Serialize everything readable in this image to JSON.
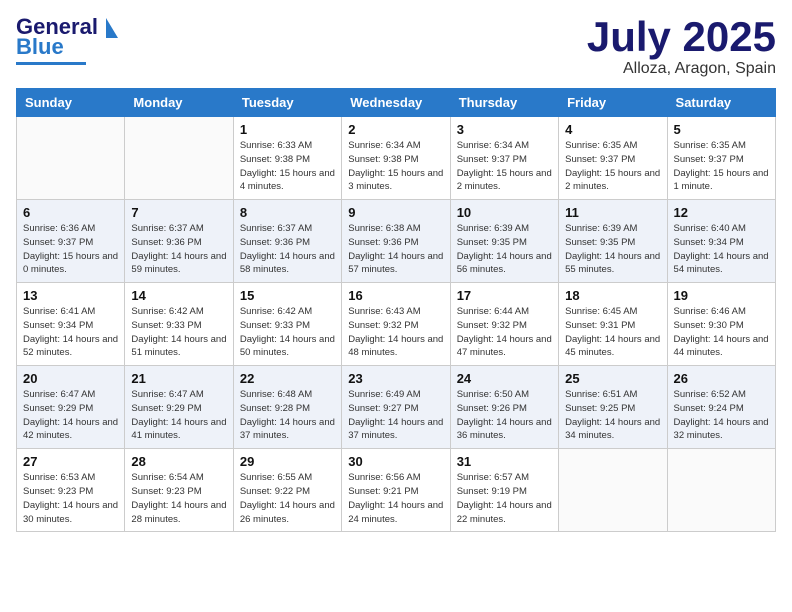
{
  "header": {
    "logo_general": "General",
    "logo_blue": "Blue",
    "month_title": "July 2025",
    "location": "Alloza, Aragon, Spain"
  },
  "weekdays": [
    "Sunday",
    "Monday",
    "Tuesday",
    "Wednesday",
    "Thursday",
    "Friday",
    "Saturday"
  ],
  "weeks": [
    [
      {
        "day": "",
        "sunrise": "",
        "sunset": "",
        "daylight": ""
      },
      {
        "day": "",
        "sunrise": "",
        "sunset": "",
        "daylight": ""
      },
      {
        "day": "1",
        "sunrise": "Sunrise: 6:33 AM",
        "sunset": "Sunset: 9:38 PM",
        "daylight": "Daylight: 15 hours and 4 minutes."
      },
      {
        "day": "2",
        "sunrise": "Sunrise: 6:34 AM",
        "sunset": "Sunset: 9:38 PM",
        "daylight": "Daylight: 15 hours and 3 minutes."
      },
      {
        "day": "3",
        "sunrise": "Sunrise: 6:34 AM",
        "sunset": "Sunset: 9:37 PM",
        "daylight": "Daylight: 15 hours and 2 minutes."
      },
      {
        "day": "4",
        "sunrise": "Sunrise: 6:35 AM",
        "sunset": "Sunset: 9:37 PM",
        "daylight": "Daylight: 15 hours and 2 minutes."
      },
      {
        "day": "5",
        "sunrise": "Sunrise: 6:35 AM",
        "sunset": "Sunset: 9:37 PM",
        "daylight": "Daylight: 15 hours and 1 minute."
      }
    ],
    [
      {
        "day": "6",
        "sunrise": "Sunrise: 6:36 AM",
        "sunset": "Sunset: 9:37 PM",
        "daylight": "Daylight: 15 hours and 0 minutes."
      },
      {
        "day": "7",
        "sunrise": "Sunrise: 6:37 AM",
        "sunset": "Sunset: 9:36 PM",
        "daylight": "Daylight: 14 hours and 59 minutes."
      },
      {
        "day": "8",
        "sunrise": "Sunrise: 6:37 AM",
        "sunset": "Sunset: 9:36 PM",
        "daylight": "Daylight: 14 hours and 58 minutes."
      },
      {
        "day": "9",
        "sunrise": "Sunrise: 6:38 AM",
        "sunset": "Sunset: 9:36 PM",
        "daylight": "Daylight: 14 hours and 57 minutes."
      },
      {
        "day": "10",
        "sunrise": "Sunrise: 6:39 AM",
        "sunset": "Sunset: 9:35 PM",
        "daylight": "Daylight: 14 hours and 56 minutes."
      },
      {
        "day": "11",
        "sunrise": "Sunrise: 6:39 AM",
        "sunset": "Sunset: 9:35 PM",
        "daylight": "Daylight: 14 hours and 55 minutes."
      },
      {
        "day": "12",
        "sunrise": "Sunrise: 6:40 AM",
        "sunset": "Sunset: 9:34 PM",
        "daylight": "Daylight: 14 hours and 54 minutes."
      }
    ],
    [
      {
        "day": "13",
        "sunrise": "Sunrise: 6:41 AM",
        "sunset": "Sunset: 9:34 PM",
        "daylight": "Daylight: 14 hours and 52 minutes."
      },
      {
        "day": "14",
        "sunrise": "Sunrise: 6:42 AM",
        "sunset": "Sunset: 9:33 PM",
        "daylight": "Daylight: 14 hours and 51 minutes."
      },
      {
        "day": "15",
        "sunrise": "Sunrise: 6:42 AM",
        "sunset": "Sunset: 9:33 PM",
        "daylight": "Daylight: 14 hours and 50 minutes."
      },
      {
        "day": "16",
        "sunrise": "Sunrise: 6:43 AM",
        "sunset": "Sunset: 9:32 PM",
        "daylight": "Daylight: 14 hours and 48 minutes."
      },
      {
        "day": "17",
        "sunrise": "Sunrise: 6:44 AM",
        "sunset": "Sunset: 9:32 PM",
        "daylight": "Daylight: 14 hours and 47 minutes."
      },
      {
        "day": "18",
        "sunrise": "Sunrise: 6:45 AM",
        "sunset": "Sunset: 9:31 PM",
        "daylight": "Daylight: 14 hours and 45 minutes."
      },
      {
        "day": "19",
        "sunrise": "Sunrise: 6:46 AM",
        "sunset": "Sunset: 9:30 PM",
        "daylight": "Daylight: 14 hours and 44 minutes."
      }
    ],
    [
      {
        "day": "20",
        "sunrise": "Sunrise: 6:47 AM",
        "sunset": "Sunset: 9:29 PM",
        "daylight": "Daylight: 14 hours and 42 minutes."
      },
      {
        "day": "21",
        "sunrise": "Sunrise: 6:47 AM",
        "sunset": "Sunset: 9:29 PM",
        "daylight": "Daylight: 14 hours and 41 minutes."
      },
      {
        "day": "22",
        "sunrise": "Sunrise: 6:48 AM",
        "sunset": "Sunset: 9:28 PM",
        "daylight": "Daylight: 14 hours and 37 minutes."
      },
      {
        "day": "23",
        "sunrise": "Sunrise: 6:49 AM",
        "sunset": "Sunset: 9:27 PM",
        "daylight": "Daylight: 14 hours and 37 minutes."
      },
      {
        "day": "24",
        "sunrise": "Sunrise: 6:50 AM",
        "sunset": "Sunset: 9:26 PM",
        "daylight": "Daylight: 14 hours and 36 minutes."
      },
      {
        "day": "25",
        "sunrise": "Sunrise: 6:51 AM",
        "sunset": "Sunset: 9:25 PM",
        "daylight": "Daylight: 14 hours and 34 minutes."
      },
      {
        "day": "26",
        "sunrise": "Sunrise: 6:52 AM",
        "sunset": "Sunset: 9:24 PM",
        "daylight": "Daylight: 14 hours and 32 minutes."
      }
    ],
    [
      {
        "day": "27",
        "sunrise": "Sunrise: 6:53 AM",
        "sunset": "Sunset: 9:23 PM",
        "daylight": "Daylight: 14 hours and 30 minutes."
      },
      {
        "day": "28",
        "sunrise": "Sunrise: 6:54 AM",
        "sunset": "Sunset: 9:23 PM",
        "daylight": "Daylight: 14 hours and 28 minutes."
      },
      {
        "day": "29",
        "sunrise": "Sunrise: 6:55 AM",
        "sunset": "Sunset: 9:22 PM",
        "daylight": "Daylight: 14 hours and 26 minutes."
      },
      {
        "day": "30",
        "sunrise": "Sunrise: 6:56 AM",
        "sunset": "Sunset: 9:21 PM",
        "daylight": "Daylight: 14 hours and 24 minutes."
      },
      {
        "day": "31",
        "sunrise": "Sunrise: 6:57 AM",
        "sunset": "Sunset: 9:19 PM",
        "daylight": "Daylight: 14 hours and 22 minutes."
      },
      {
        "day": "",
        "sunrise": "",
        "sunset": "",
        "daylight": ""
      },
      {
        "day": "",
        "sunrise": "",
        "sunset": "",
        "daylight": ""
      }
    ]
  ]
}
